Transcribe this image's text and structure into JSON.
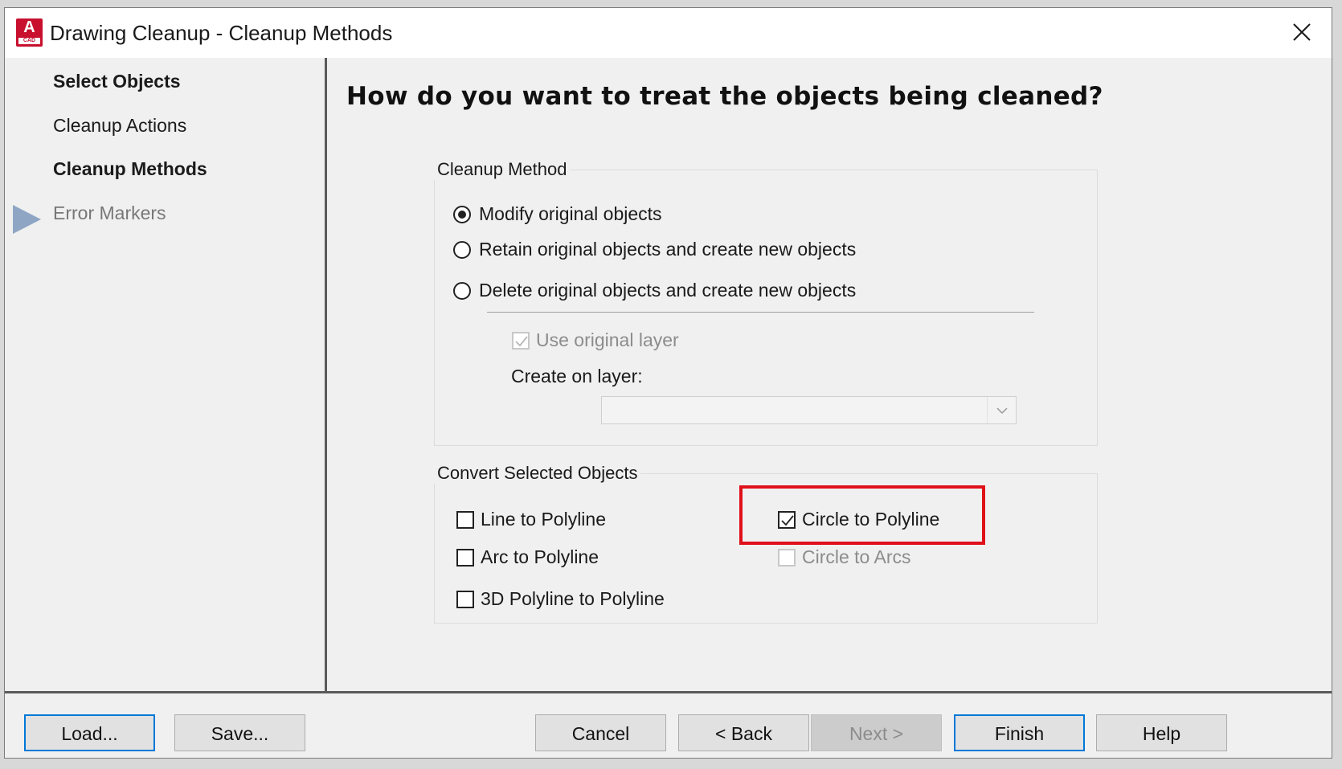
{
  "window": {
    "title": "Drawing Cleanup - Cleanup Methods",
    "app_icon_letter": "A",
    "app_icon_sub": "CAD",
    "app_icon_color": "#c8102e"
  },
  "sidebar": {
    "steps": [
      {
        "label": "Select Objects",
        "state": "completed"
      },
      {
        "label": "Cleanup Actions",
        "state": "completed"
      },
      {
        "label": "Cleanup Methods",
        "state": "current"
      },
      {
        "label": "Error Markers",
        "state": "pending"
      }
    ]
  },
  "main": {
    "heading": "How do you want to treat the objects being cleaned?",
    "cleanup_method": {
      "label": "Cleanup Method",
      "options": [
        {
          "label": "Modify original objects",
          "selected": true
        },
        {
          "label": "Retain original objects and create new objects",
          "selected": false
        },
        {
          "label": "Delete original objects and create new objects",
          "selected": false
        }
      ],
      "use_original_layer": {
        "label": "Use original layer",
        "checked": true,
        "enabled": false
      },
      "create_on_layer": {
        "label": "Create on layer:",
        "value": ""
      }
    },
    "convert": {
      "label": "Convert Selected Objects",
      "options": [
        {
          "label": "Line to Polyline",
          "checked": false,
          "enabled": true
        },
        {
          "label": "Arc to Polyline",
          "checked": false,
          "enabled": true
        },
        {
          "label": "3D Polyline to Polyline",
          "checked": false,
          "enabled": true
        },
        {
          "label": "Circle to Polyline",
          "checked": true,
          "enabled": true
        },
        {
          "label": "Circle to Arcs",
          "checked": false,
          "enabled": false
        }
      ]
    }
  },
  "footer": {
    "load": "Load...",
    "save": "Save...",
    "cancel": "Cancel",
    "back": "< Back",
    "next": "Next >",
    "finish": "Finish",
    "help": "Help"
  },
  "colors": {
    "highlight": "#e0101a",
    "step_arrow": "#8ea6c4",
    "primary_border": "#0078d7"
  }
}
